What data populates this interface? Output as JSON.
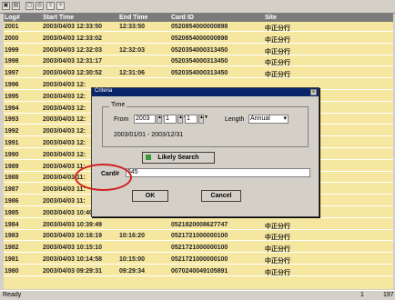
{
  "toolbar": {
    "buttons": [
      "save-icon",
      "print-icon",
      "zoom-icon",
      "search-icon",
      "export-icon",
      "close-icon"
    ]
  },
  "table": {
    "headers": [
      "Log#",
      "Start Time",
      "End Time",
      "Card ID",
      "Site"
    ],
    "rows": [
      [
        "2001",
        "2003/04/03 12:33:50",
        "12:33:50",
        "0520854000000898",
        "中正分行"
      ],
      [
        "2000",
        "2003/04/03 12:33:02",
        "",
        "0520854000000898",
        "中正分行"
      ],
      [
        "1999",
        "2003/04/03 12:32:03",
        "12:32:03",
        "0520354000313450",
        "中正分行"
      ],
      [
        "1998",
        "2003/04/03 12:31:17",
        "",
        "0520354000313450",
        "中正分行"
      ],
      [
        "1997",
        "2003/04/03 12:30:52",
        "12:31:06",
        "0520354000313450",
        "中正分行"
      ],
      [
        "1996",
        "2003/04/03 12:",
        "",
        "",
        ""
      ],
      [
        "1995",
        "2003/04/03 12:",
        "",
        "",
        ""
      ],
      [
        "1994",
        "2003/04/03 12:",
        "",
        "",
        ""
      ],
      [
        "1993",
        "2003/04/03 12:",
        "",
        "",
        ""
      ],
      [
        "1992",
        "2003/04/03 12:",
        "",
        "",
        ""
      ],
      [
        "1991",
        "2003/04/03 12:",
        "",
        "",
        ""
      ],
      [
        "1990",
        "2003/04/03 12:",
        "",
        "",
        ""
      ],
      [
        "1989",
        "2003/04/03 11:",
        "",
        "",
        ""
      ],
      [
        "1988",
        "2003/04/03 11:",
        "",
        "",
        ""
      ],
      [
        "1987",
        "2003/04/03 11:",
        "",
        "",
        ""
      ],
      [
        "1986",
        "2003/04/03 11:",
        "",
        "",
        ""
      ],
      [
        "1985",
        "2003/04/03 10:40:00",
        "10:40:06",
        "0521820008627747",
        "中正分行"
      ],
      [
        "1984",
        "2003/04/03 10:39:49",
        "",
        "0521820008627747",
        "中正分行"
      ],
      [
        "1983",
        "2003/04/03 10:16:19",
        "10:16:20",
        "0521721000000100",
        "中正分行"
      ],
      [
        "1982",
        "2003/04/03 10:15:10",
        "",
        "0521721000000100",
        "中正分行"
      ],
      [
        "1981",
        "2003/04/03 10:14:58",
        "10:15:00",
        "0521721000000100",
        "中正分行"
      ],
      [
        "1980",
        "2003/04/03 09:29:31",
        "09:29:34",
        "0070240049105891",
        "中正分行"
      ]
    ]
  },
  "status": {
    "left": "Ready",
    "right1": "1",
    "right2": "197"
  },
  "dialog": {
    "title": "Criteria",
    "group_label": "Time",
    "from_label": "From",
    "year": "2003",
    "month": "1",
    "day": "1",
    "length_label": "Length",
    "length_value": "Annual",
    "range": "2003/01/01 - 2003/12/31",
    "likely_label": "Likely Search",
    "card_label": "Card#",
    "card_value": "645",
    "ok_label": "OK",
    "cancel_label": "Cancel"
  },
  "colors": {
    "row_bg": "#f6e7a0",
    "header_bg": "#7b7b7b",
    "title_bg": "#0a246a",
    "highlight": "#d02020"
  }
}
